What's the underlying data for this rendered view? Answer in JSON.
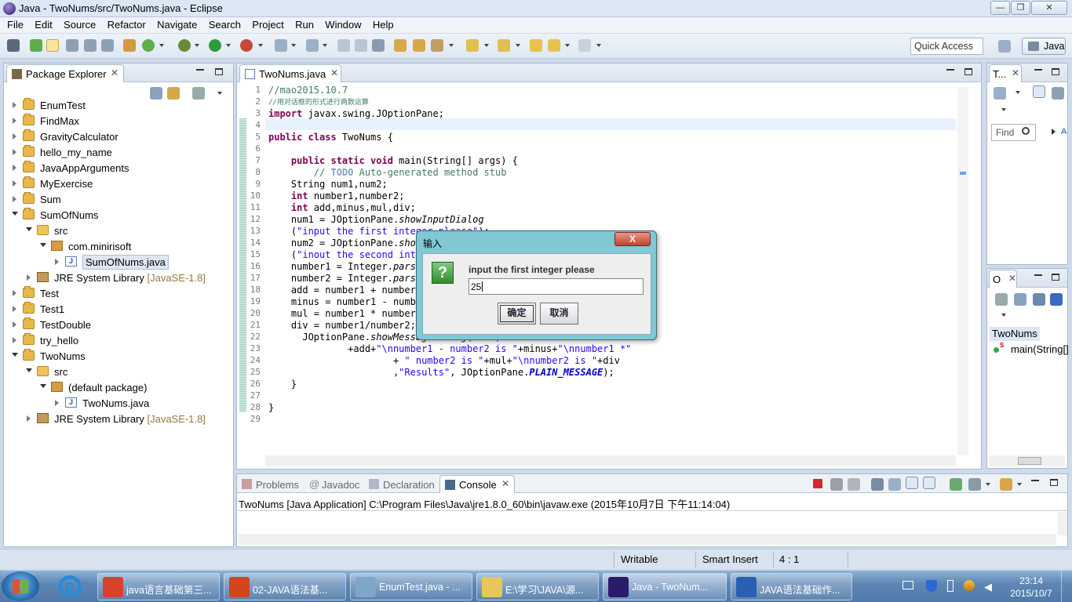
{
  "window": {
    "title": "Java - TwoNums/src/TwoNums.java - Eclipse"
  },
  "menu": [
    "File",
    "Edit",
    "Source",
    "Refactor",
    "Navigate",
    "Search",
    "Project",
    "Run",
    "Window",
    "Help"
  ],
  "toolbar": {
    "quick_access": "Quick Access",
    "perspective": "Java"
  },
  "package_explorer": {
    "tab": "Package Explorer",
    "items": [
      {
        "label": "EnumTest",
        "type": "project"
      },
      {
        "label": "FindMax",
        "type": "project"
      },
      {
        "label": "GravityCalculator",
        "type": "project"
      },
      {
        "label": "hello_my_name",
        "type": "project"
      },
      {
        "label": "JavaAppArguments",
        "type": "project"
      },
      {
        "label": "MyExercise",
        "type": "project"
      },
      {
        "label": "Sum",
        "type": "project"
      },
      {
        "label": "SumOfNums",
        "type": "project"
      },
      {
        "label": "src",
        "type": "src"
      },
      {
        "label": "com.minirisoft",
        "type": "package"
      },
      {
        "label": "SumOfNums.java",
        "type": "java"
      },
      {
        "label": "JRE System Library",
        "suffix": "[JavaSE-1.8]",
        "type": "library"
      },
      {
        "label": "Test",
        "type": "project"
      },
      {
        "label": "Test1",
        "type": "project"
      },
      {
        "label": "TestDouble",
        "type": "project"
      },
      {
        "label": "try_hello",
        "type": "project"
      },
      {
        "label": "TwoNums",
        "type": "project"
      },
      {
        "label": "src",
        "type": "src"
      },
      {
        "label": "(default package)",
        "type": "package"
      },
      {
        "label": "TwoNums.java",
        "type": "java"
      },
      {
        "label": "JRE System Library",
        "suffix": "[JavaSE-1.8]",
        "type": "library"
      }
    ]
  },
  "editor": {
    "tab": "TwoNums.java",
    "line_numbers": [
      "1",
      "2",
      "3",
      "4",
      "5",
      "6",
      "7",
      "8",
      "9",
      "10",
      "11",
      "12",
      "13",
      "14",
      "15",
      "16",
      "17",
      "18",
      "19",
      "20",
      "21",
      "22",
      "23",
      "24",
      "25",
      "26",
      "27",
      "28",
      "29"
    ]
  },
  "outline": {
    "tab_task": "T...",
    "find_placeholder": "Find",
    "find_all": "A",
    "tab_outline": "O",
    "class_name": "TwoNums",
    "method": "main(String[]"
  },
  "dialog": {
    "title": "输入",
    "close": "X",
    "icon": "?",
    "message": "input the first integer please",
    "value": "25",
    "ok": "确定",
    "cancel": "取消"
  },
  "bottom": {
    "tabs": {
      "problems": "Problems",
      "javadoc": "Javadoc",
      "declaration": "Declaration",
      "console": "Console"
    },
    "console_header": "TwoNums [Java Application] C:\\Program Files\\Java\\jre1.8.0_60\\bin\\javaw.exe (2015年10月7日 下午11:14:04)"
  },
  "status": {
    "writable": "Writable",
    "insert": "Smart Insert",
    "position": "4 : 1"
  },
  "taskbar": {
    "buttons": [
      {
        "label": "java语言基础第三...",
        "color": "#d9412f"
      },
      {
        "label": "02-JAVA语法基...",
        "color": "#d2451e"
      },
      {
        "label": "EnumTest.java - ...",
        "color": "#7ea6c8"
      },
      {
        "label": "E:\\学习\\JAVA\\源...",
        "color": "#e8c65a"
      },
      {
        "label": "Java - TwoNum...",
        "color": "#2c1b6d"
      },
      {
        "label": "JAVA语法基础作...",
        "color": "#2b5fb3"
      }
    ],
    "time": "23:14",
    "date": "2015/10/7"
  }
}
